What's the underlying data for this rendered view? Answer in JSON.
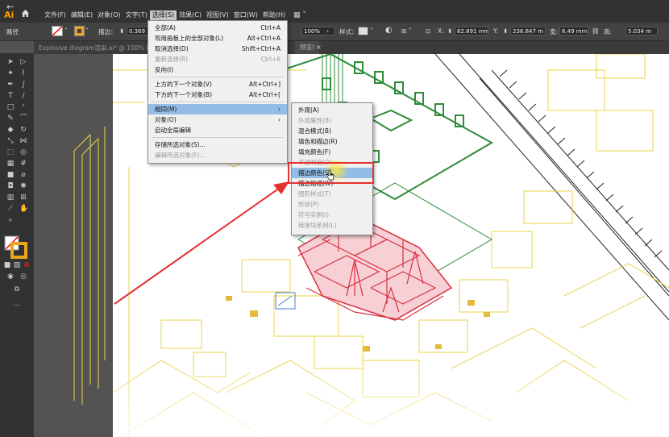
{
  "app": {
    "logo": "Ai",
    "back_glyph": "←",
    "document_tab": "Explosive diagram渲染.ai* @ 100% (预览",
    "tab2": "预览)"
  },
  "menubar": [
    "文件(F)",
    "编辑(E)",
    "对象(O)",
    "文字(T)",
    "选择(S)",
    "效果(C)",
    "视图(V)",
    "窗口(W)",
    "帮助(H)"
  ],
  "active_menu": "选择(S)",
  "control_bar": {
    "selection_type": "路径",
    "stroke_label": "描边：",
    "stroke_value": "0.369",
    "opacity_value": "100%",
    "style_label": "样式：",
    "x_label": "X:",
    "x_value": "62.891 mm",
    "y_label": "Y:",
    "y_value": "236.847 m",
    "w_label": "宽:",
    "w_value": "6.49 mm",
    "h_label": "高:",
    "h_value": "5.034 m"
  },
  "select_menu": {
    "items": [
      {
        "label": "全部(A)",
        "shortcut": "Ctrl+A",
        "disabled": false
      },
      {
        "label": "现用画板上的全部对象(L)",
        "shortcut": "Alt+Ctrl+A",
        "disabled": false
      },
      {
        "label": "取消选择(D)",
        "shortcut": "Shift+Ctrl+A",
        "disabled": false
      },
      {
        "label": "重新选择(R)",
        "shortcut": "Ctrl+6",
        "disabled": true
      },
      {
        "label": "反向(I)",
        "shortcut": "",
        "disabled": false
      },
      {
        "label": "上方的下一个对象(V)",
        "shortcut": "Alt+Ctrl+]",
        "disabled": false
      },
      {
        "label": "下方的下一个对象(B)",
        "shortcut": "Alt+Ctrl+[",
        "disabled": false
      },
      {
        "label": "相同(M)",
        "shortcut": "›",
        "disabled": false,
        "highlighted": true
      },
      {
        "label": "对象(O)",
        "shortcut": "›",
        "disabled": false
      },
      {
        "label": "启动全局编辑",
        "shortcut": "",
        "disabled": false
      },
      {
        "label": "存储所选对象(S)...",
        "shortcut": "",
        "disabled": false
      },
      {
        "label": "编辑所选对象(E)...",
        "shortcut": "",
        "disabled": true
      }
    ]
  },
  "same_submenu": {
    "items": [
      {
        "label": "外观(A)",
        "disabled": false
      },
      {
        "label": "外观属性(B)",
        "disabled": true
      },
      {
        "label": "混合模式(B)",
        "disabled": false
      },
      {
        "label": "填色和描边(R)",
        "disabled": false
      },
      {
        "label": "填充颜色(F)",
        "disabled": false
      },
      {
        "label": "不透明度(O)",
        "disabled": true
      },
      {
        "label": "描边颜色(S)",
        "disabled": false,
        "highlighted": true
      },
      {
        "label": "描边粗细(W)",
        "disabled": false
      },
      {
        "label": "图形样式(T)",
        "disabled": true
      },
      {
        "label": "形状(P)",
        "disabled": true
      },
      {
        "label": "符号实例(I)",
        "disabled": true
      },
      {
        "label": "链接块系列(L)",
        "disabled": true
      }
    ]
  },
  "colors": {
    "accent": "#ff9a00",
    "highlight": "#94bde5",
    "annotation_red": "#e53030",
    "drawing_yellow": "#e8d44a",
    "drawing_green": "#2e8b3a",
    "drawing_red": "#d8303f"
  }
}
